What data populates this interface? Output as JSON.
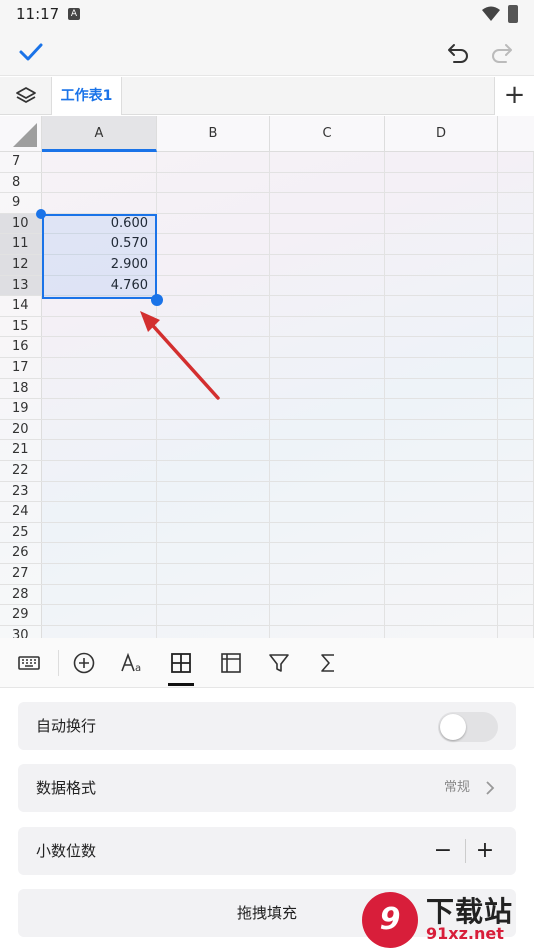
{
  "status_bar": {
    "time": "11:17",
    "notification_icon": "A"
  },
  "toolbar": {
    "confirm_icon": "check-icon",
    "undo_icon": "undo-icon",
    "redo_icon": "redo-icon"
  },
  "sheets": {
    "active_tab": "工作表1",
    "add_label": "+"
  },
  "grid": {
    "columns": [
      "A",
      "B",
      "C",
      "D"
    ],
    "rows": [
      {
        "num": "7",
        "a": ""
      },
      {
        "num": "8",
        "a": ""
      },
      {
        "num": "9",
        "a": ""
      },
      {
        "num": "10",
        "a": "0.600"
      },
      {
        "num": "11",
        "a": "0.570"
      },
      {
        "num": "12",
        "a": "2.900"
      },
      {
        "num": "13",
        "a": "4.760"
      },
      {
        "num": "14",
        "a": ""
      },
      {
        "num": "15",
        "a": ""
      },
      {
        "num": "16",
        "a": ""
      },
      {
        "num": "17",
        "a": ""
      },
      {
        "num": "18",
        "a": ""
      },
      {
        "num": "19",
        "a": ""
      },
      {
        "num": "20",
        "a": ""
      },
      {
        "num": "21",
        "a": ""
      },
      {
        "num": "22",
        "a": ""
      },
      {
        "num": "23",
        "a": ""
      },
      {
        "num": "24",
        "a": ""
      },
      {
        "num": "25",
        "a": ""
      },
      {
        "num": "26",
        "a": ""
      },
      {
        "num": "27",
        "a": ""
      },
      {
        "num": "28",
        "a": ""
      },
      {
        "num": "29",
        "a": ""
      },
      {
        "num": "30",
        "a": ""
      }
    ]
  },
  "bottom_toolbar": {
    "icons": [
      "keyboard-icon",
      "insert-icon",
      "text-format-icon",
      "cell-format-icon",
      "table-icon",
      "filter-icon",
      "sum-icon"
    ],
    "active": "cell-format-icon"
  },
  "settings": {
    "wrap_text_label": "自动换行",
    "wrap_text_on": false,
    "data_format_label": "数据格式",
    "data_format_value": "常规",
    "decimal_places_label": "小数位数",
    "minus": "−",
    "plus": "+",
    "drag_fill_label": "拖拽填充"
  },
  "watermark": {
    "logo_text": "9",
    "site_name": "下载站",
    "url": "91xz.net"
  },
  "colors": {
    "accent": "#1a73e8",
    "arrow": "#d32f2f",
    "watermark": "#d81e3a"
  }
}
